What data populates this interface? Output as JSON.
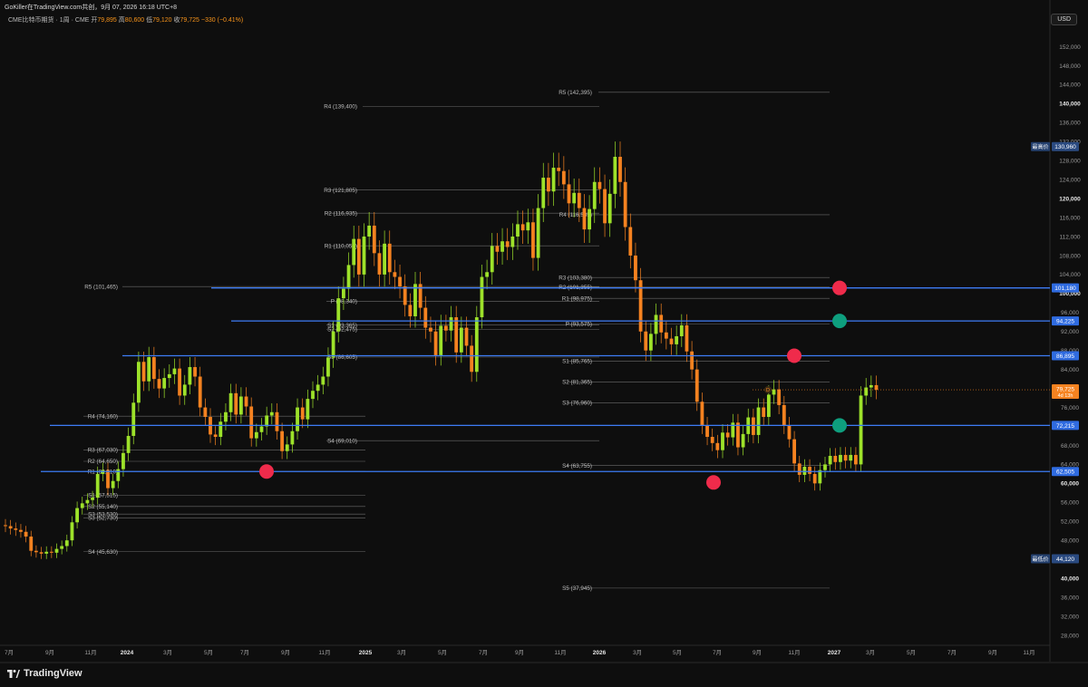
{
  "header": {
    "text": "GoKiller在TradingView.com共创，9月 07, 2026 16:18 UTC+8"
  },
  "symbol": {
    "name": "CME比特币期货 · 1周 · CME",
    "open_label": "开",
    "open": "79,895",
    "high_label": "高",
    "high": "80,600",
    "low_label": "低",
    "low": "79,120",
    "close_label": "收",
    "close": "79,725",
    "change": "−330 (−0.41%)"
  },
  "currency": "USD",
  "footer": {
    "brand": "TradingView"
  },
  "colors": {
    "up": "#9de22a",
    "down": "#f58220",
    "level": "#3d7cf5",
    "pivot": "#8a8a8a",
    "dot_red": "#ef2b4b",
    "dot_green": "#0e9f7e"
  },
  "chart_data": {
    "type": "candlestick",
    "interval": "1周",
    "y_range": [
      26000,
      156000
    ],
    "y_ticks": [
      "152,000",
      "148,000",
      "144,000",
      "140,000",
      "136,000",
      "132,000",
      "128,000",
      "124,000",
      "120,000",
      "116,000",
      "112,000",
      "108,000",
      "104,000",
      "100,000",
      "96,000",
      "92,000",
      "88,000",
      "84,000",
      "80,000",
      "76,000",
      "72,000",
      "68,000",
      "64,000",
      "60,000",
      "56,000",
      "52,000",
      "48,000",
      "44,000",
      "40,000",
      "36,000",
      "32,000",
      "28,000"
    ],
    "x_ticks": [
      "7月",
      "9月",
      "11月",
      "2024",
      "3月",
      "5月",
      "7月",
      "9月",
      "11月",
      "2025",
      "3月",
      "5月",
      "7月",
      "9月",
      "11月",
      "2026",
      "3月",
      "5月",
      "7月",
      "9月",
      "11月",
      "2027",
      "3月",
      "5月",
      "7月",
      "9月",
      "11月"
    ],
    "horizontal_levels": [
      {
        "price": 101180,
        "label": "101,180",
        "from": "2024-11"
      },
      {
        "price": 94225,
        "label": "94,225",
        "from": "2024-12"
      },
      {
        "price": 86895,
        "label": "86,895",
        "from": "2023-11"
      },
      {
        "price": 72215,
        "label": "72,215",
        "from": "2023-08"
      },
      {
        "price": 62505,
        "label": "62,505",
        "from": "2023-08"
      }
    ],
    "price_labels": [
      {
        "price": 130960,
        "tag": "最高价",
        "label": "130,960"
      },
      {
        "price": 79725,
        "tag": "",
        "label": "79,725",
        "sub": "4d 13h"
      },
      {
        "price": 44120,
        "tag": "最低价",
        "label": "44,120"
      }
    ],
    "pivot_sets": [
      {
        "year": "2024",
        "levels": [
          {
            "name": "R4",
            "value": "74,160",
            "price": 74160
          },
          {
            "name": "R3",
            "value": "67,030",
            "price": 67030
          },
          {
            "name": "R2",
            "value": "64,650",
            "price": 64650
          },
          {
            "name": "R1",
            "value": "62,510",
            "price": 62510
          },
          {
            "name": "S1",
            "value": "57,515",
            "price": 57515
          },
          {
            "name": "S2",
            "value": "55,140",
            "price": 55140
          },
          {
            "name": "S3",
            "value": "53,530",
            "price": 53530
          },
          {
            "name": "S3",
            "value": "52,730",
            "price": 52730
          },
          {
            "name": "S4",
            "value": "45,630",
            "price": 45630
          }
        ]
      },
      {
        "year": "2025",
        "levels": [
          {
            "name": "R5",
            "value": "101,465",
            "price": 101465
          },
          {
            "name": "R4",
            "value": "139,400",
            "price": 139400
          },
          {
            "name": "R3",
            "value": "121,805",
            "price": 121805
          },
          {
            "name": "R2",
            "value": "116,935",
            "price": 116935
          },
          {
            "name": "R1",
            "value": "110,050",
            "price": 110050
          },
          {
            "name": "P",
            "value": "98,340",
            "price": 98340
          },
          {
            "name": "S1",
            "value": "93,365",
            "price": 93365
          },
          {
            "name": "S2",
            "value": "92,475",
            "price": 92475
          },
          {
            "name": "S3",
            "value": "86,605",
            "price": 86605
          },
          {
            "name": "S4",
            "value": "69,010",
            "price": 69010
          }
        ]
      },
      {
        "year": "2026",
        "levels": [
          {
            "name": "R5",
            "value": "142,395",
            "price": 142395
          },
          {
            "name": "R4",
            "value": "116,585",
            "price": 116585
          },
          {
            "name": "R3",
            "value": "103,380",
            "price": 103380
          },
          {
            "name": "R2",
            "value": "101,355",
            "price": 101355
          },
          {
            "name": "R1",
            "value": "98,975",
            "price": 98975
          },
          {
            "name": "P",
            "value": "93,575",
            "price": 93575
          },
          {
            "name": "S1",
            "value": "85,765",
            "price": 85765
          },
          {
            "name": "S2",
            "value": "81,365",
            "price": 81365
          },
          {
            "name": "S3",
            "value": "76,960",
            "price": 76960
          },
          {
            "name": "S4",
            "value": "63,755",
            "price": 63755
          },
          {
            "name": "S5",
            "value": "37,945",
            "price": 37945
          }
        ]
      }
    ],
    "signal_dots": [
      {
        "date": "2024-08",
        "price": 62505,
        "color": "red"
      },
      {
        "date": "2026-06",
        "price": 60200,
        "color": "red"
      },
      {
        "date": "2026-11",
        "price": 86895,
        "color": "red"
      },
      {
        "date": "2026-12",
        "price": 101180,
        "color": "red"
      },
      {
        "date": "2026-12",
        "price": 94225,
        "color": "green"
      },
      {
        "date": "2026-12",
        "price": 72215,
        "color": "green"
      }
    ],
    "candles_close": [
      51000,
      50500,
      50200,
      49800,
      48800,
      45800,
      45500,
      45200,
      45600,
      45400,
      46200,
      46800,
      48000,
      51800,
      54800,
      55800,
      56500,
      57000,
      62000,
      62800,
      59000,
      60500,
      63000,
      66400,
      70000,
      77000,
      85600,
      81500,
      86600,
      82000,
      80000,
      82200,
      83000,
      84200,
      78500,
      80800,
      84500,
      82500,
      76000,
      74000,
      70300,
      69800,
      73000,
      75000,
      79000,
      74500,
      78300,
      76200,
      69500,
      70800,
      72000,
      74300,
      75000,
      71000,
      66800,
      68200,
      71000,
      76000,
      73500,
      77800,
      79500,
      80800,
      82500,
      86500,
      92000,
      99000,
      101000,
      106000,
      111500,
      104000,
      112000,
      114300,
      108500,
      104000,
      110500,
      104500,
      103500,
      101500,
      97600,
      95200,
      102000,
      97000,
      92800,
      92000,
      87000,
      93200,
      92200,
      95000,
      87600,
      92800,
      89000,
      83500,
      95000,
      103500,
      104500,
      110000,
      108800,
      111000,
      109800,
      112000,
      114600,
      113300,
      115000,
      107500,
      118000,
      124400,
      121500,
      126500,
      125800,
      123000,
      119000,
      121200,
      118000,
      113500,
      117800,
      123500,
      122000,
      114800,
      121000,
      128800,
      123500,
      114000,
      108000,
      102800,
      92000,
      88000,
      91500,
      95500,
      91800,
      90500,
      89300,
      91000,
      93300,
      87800,
      84000,
      77200,
      72200,
      69800,
      68500,
      67000,
      70700,
      69700,
      72800,
      67600,
      70400,
      73900,
      70200,
      76000,
      74000,
      78700,
      79800,
      76500,
      72200,
      69300,
      64200,
      61800,
      63500,
      62000,
      60000,
      62800,
      64000,
      65800,
      64500,
      66000,
      64800,
      66000,
      64000,
      78500,
      80200,
      80700,
      79725
    ]
  }
}
